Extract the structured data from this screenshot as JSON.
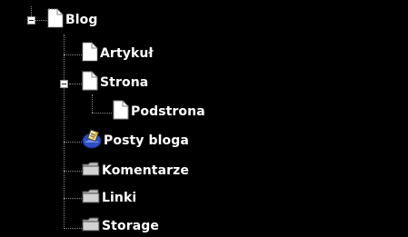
{
  "tree": {
    "root": {
      "label": "Blog",
      "icon": "page-icon",
      "expanded": true,
      "children": [
        {
          "label": "Artykuł",
          "icon": "page-icon"
        },
        {
          "label": "Strona",
          "icon": "page-icon",
          "expanded": true,
          "children": [
            {
              "label": "Podstrona",
              "icon": "page-icon"
            }
          ]
        },
        {
          "label": "Posty bloga",
          "icon": "blog-plugin-icon"
        },
        {
          "label": "Komentarze",
          "icon": "folder-icon"
        },
        {
          "label": "Linki",
          "icon": "folder-icon"
        },
        {
          "label": "Storage",
          "icon": "folder-icon"
        }
      ]
    }
  },
  "colors": {
    "background": "#000000",
    "text": "#ffffff",
    "connector": "#8a8a8a",
    "folder_fill": "#bdbdbd",
    "blog_icon_blue": "#2d4fc4"
  }
}
